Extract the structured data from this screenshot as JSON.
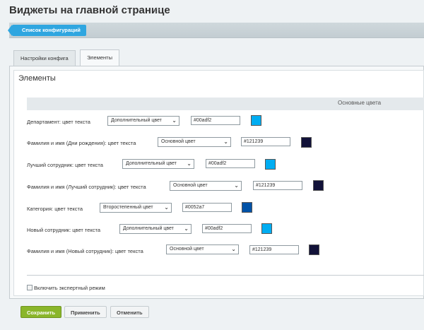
{
  "header": {
    "title": "Виджеты на главной странице"
  },
  "toolbar": {
    "config_list_label": "Список конфигураций"
  },
  "tabs": [
    {
      "label": "Настройки конфига"
    },
    {
      "label": "Элементы"
    }
  ],
  "section": {
    "title": "Элементы",
    "colors_header": "Основные цвета"
  },
  "rows": [
    {
      "label": "Департамент: цвет текста",
      "select": "Дополнительный цвет",
      "value": "#00adf2",
      "color": "#00adf2"
    },
    {
      "label": "Фамилия и имя (Дни рождения): цвет текста",
      "select": "Основной цвет",
      "value": "#121239",
      "color": "#121239"
    },
    {
      "label": "Лучший сотрудник: цвет текста",
      "select": "Дополнительный цвет",
      "value": "#00adf2",
      "color": "#00adf2"
    },
    {
      "label": "Фамилия и имя (Лучший сотрудник): цвет текста",
      "select": "Основной цвет",
      "value": "#121239",
      "color": "#121239"
    },
    {
      "label": "Категория: цвет текста",
      "select": "Второстепенный цвет",
      "value": "#0052a7",
      "color": "#0052a7"
    },
    {
      "label": "Новый сотрудник: цвет текста",
      "select": "Дополнительный цвет",
      "value": "#00adf2",
      "color": "#00adf2"
    },
    {
      "label": "Фамилия и имя (Новый сотрудник): цвет текста",
      "select": "Основной цвет",
      "value": "#121239",
      "color": "#121239"
    }
  ],
  "expert_mode": {
    "label": "Включить экспертный режим",
    "checked": false
  },
  "footer": {
    "save_label": "Сохранить",
    "apply_label": "Применить",
    "cancel_label": "Отменить"
  }
}
